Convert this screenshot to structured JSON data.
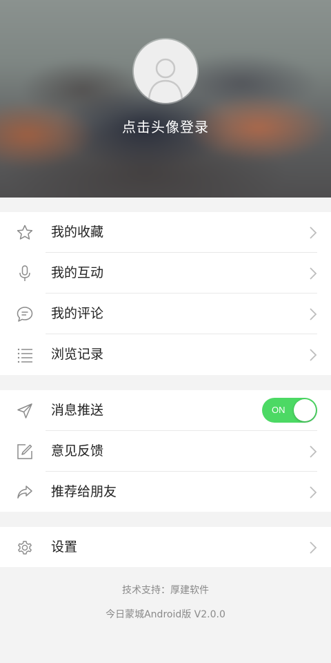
{
  "header": {
    "login_prompt": "点击头像登录"
  },
  "menu_group_1": {
    "items": [
      {
        "label": "我的收藏",
        "icon": "star-icon"
      },
      {
        "label": "我的互动",
        "icon": "microphone-icon"
      },
      {
        "label": "我的评论",
        "icon": "comment-icon"
      },
      {
        "label": "浏览记录",
        "icon": "list-icon"
      }
    ]
  },
  "menu_group_2": {
    "items": [
      {
        "label": "消息推送",
        "icon": "send-icon",
        "toggle": {
          "state": "ON"
        }
      },
      {
        "label": "意见反馈",
        "icon": "edit-icon"
      },
      {
        "label": "推荐给朋友",
        "icon": "share-icon"
      }
    ]
  },
  "menu_group_3": {
    "items": [
      {
        "label": "设置",
        "icon": "gear-icon"
      }
    ]
  },
  "footer": {
    "support": "技术支持：厚建软件",
    "version": "今日蒙城Android版 V2.0.0"
  },
  "colors": {
    "toggle_on": "#4cd964",
    "background": "#f3f3f3",
    "text": "#222222",
    "footer_text": "#8a8a8a"
  }
}
